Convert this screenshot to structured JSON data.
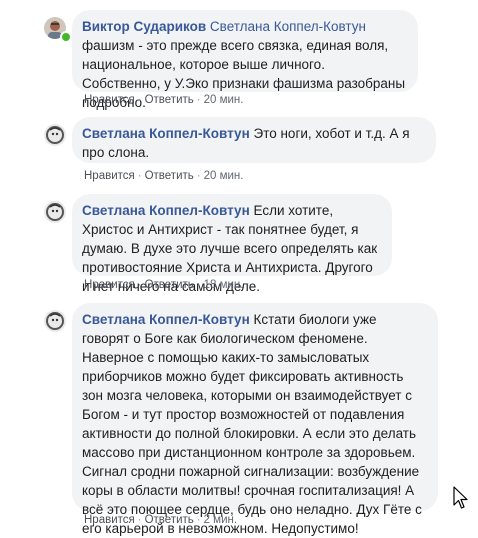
{
  "comments": [
    {
      "author": "Виктор Судариков",
      "mention": "Светлана Коппел-Ковтун",
      "text": " фашизм - это прежде всего связка, единая воля, национальное, которое выше личного. Собственно, у У.Эко признаки фашизма разобраны подробно.",
      "like_label": "Нравится",
      "reply_label": "Ответить",
      "time": "20 мин.",
      "online": true,
      "avatar_icon": "user-photo-avatar"
    },
    {
      "author": "Светлана Коппел-Ковтун",
      "text": " Это ноги, хобот и т.д. А я про слона.",
      "like_label": "Нравится",
      "reply_label": "Ответить",
      "time": "20 мин.",
      "avatar_icon": "user-portrait-avatar"
    },
    {
      "author": "Светлана Коппел-Ковтун",
      "text": " Если хотите, Христос и Антихрист - так понятнее будет, я думаю. В духе это лучше всего определять как противостояние Христа и Антихриста. Другого и нет ничего на самом деле.",
      "like_label": "Нравится",
      "reply_label": "Ответить",
      "time": "18 мин.",
      "avatar_icon": "user-portrait-avatar"
    },
    {
      "author": "Светлана Коппел-Ковтун",
      "text": " Кстати биологи уже говорят о Боге как биологическом феномене. Наверное с помощью каких-то замысловатых приборчиков можно будет фиксировать активность зон мозга человека, которыми он взаимодействует с Богом - и тут простор возможностей от подавления активности до полной блокировки. А если это делать массово при дистанционном контроле за здоровьем. Сигнал сродни пожарной сигнализации: возбуждение коры в области молитвы! срочная госпитализация! А всё это поющее сердце, будь оно неладно. Дух Гёте с его карьерой в невозможном. Недопустимо!",
      "like_label": "Нравится",
      "reply_label": "Ответить",
      "time": "2 мин.",
      "avatar_icon": "user-portrait-avatar"
    }
  ],
  "separator": "·",
  "colors": {
    "link": "#385898",
    "bubble": "#f2f3f5",
    "meta": "#606770",
    "online": "#42b72a"
  },
  "cursor_icon": "mouse-pointer-icon"
}
